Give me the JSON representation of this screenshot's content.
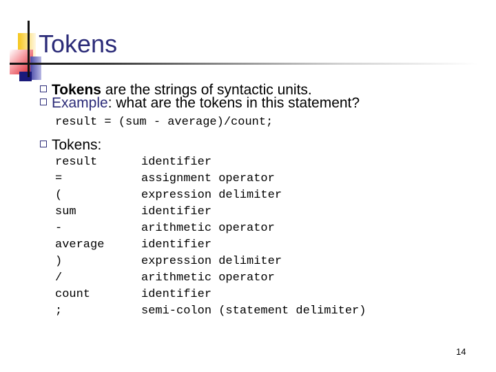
{
  "slide": {
    "title": "Tokens",
    "bullets": {
      "first_bold": "Tokens",
      "first_rest": " are the strings of syntactic units.",
      "second_label": "Example",
      "second_rest": ":  what are the tokens in this statement?",
      "third": "Tokens:"
    },
    "statement": "result = (sum - average)/count;",
    "tokens": [
      {
        "token": "result",
        "category": "identifier"
      },
      {
        "token": "=",
        "category": "assignment operator"
      },
      {
        "token": "(",
        "category": "expression delimiter"
      },
      {
        "token": "sum",
        "category": "identifier"
      },
      {
        "token": "-",
        "category": "arithmetic operator"
      },
      {
        "token": "average",
        "category": "identifier"
      },
      {
        "token": ")",
        "category": "expression delimiter"
      },
      {
        "token": "/",
        "category": "arithmetic operator"
      },
      {
        "token": "count",
        "category": "identifier"
      },
      {
        "token": ";",
        "category": "semi-colon (statement delimiter)"
      }
    ],
    "page_number": "14"
  },
  "colors": {
    "title": "#2b2b78",
    "bullet_box": "#2b2b78"
  }
}
